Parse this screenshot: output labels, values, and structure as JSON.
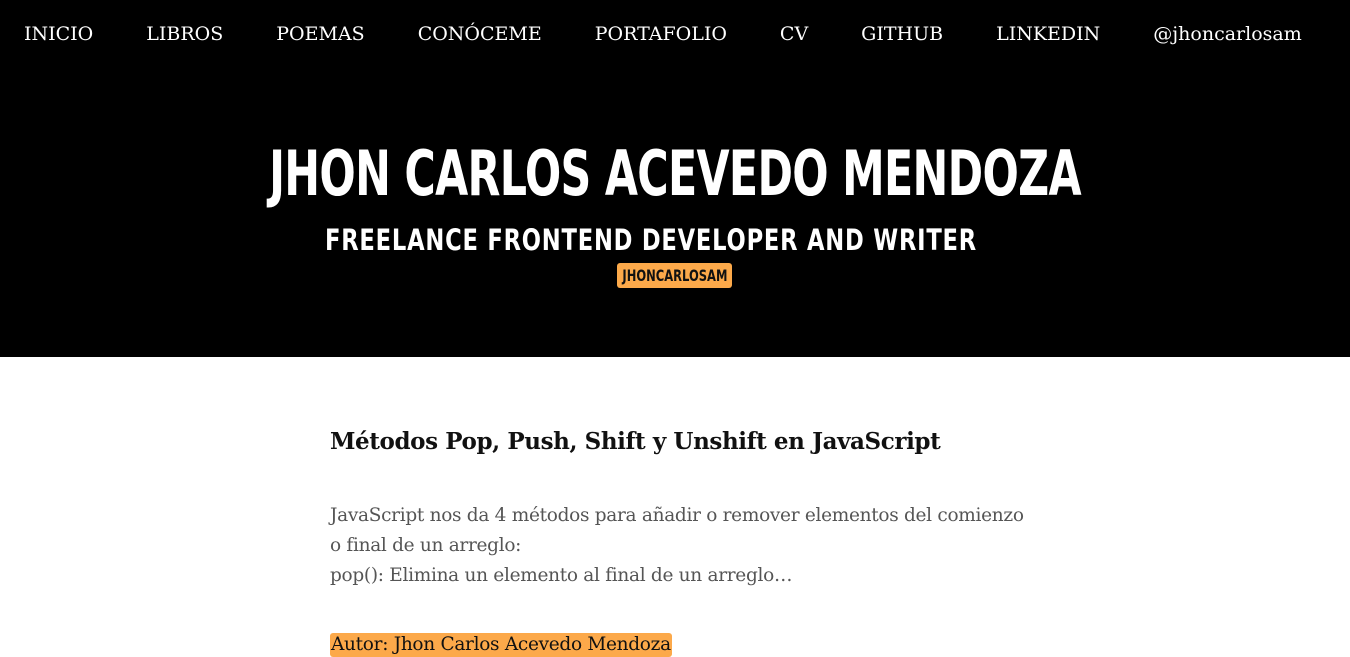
{
  "nav": {
    "items": [
      {
        "label": "INICIO"
      },
      {
        "label": "LIBROS"
      },
      {
        "label": "POEMAS"
      },
      {
        "label": "CONÓCEME"
      },
      {
        "label": "PORTAFOLIO"
      },
      {
        "label": "CV"
      },
      {
        "label": "GITHUB"
      },
      {
        "label": "LINKEDIN"
      },
      {
        "label": "@jhoncarlosam"
      }
    ]
  },
  "hero": {
    "title": "JHON CARLOS ACEVEDO MENDOZA",
    "subtitle": "FREELANCE FRONTEND DEVELOPER AND WRITER",
    "badge": "JHONCARLOSAM"
  },
  "post": {
    "title": "Métodos Pop, Push, Shift y Unshift en JavaScript",
    "excerpt_lines": [
      "JavaScript nos da 4 métodos para añadir o remover elementos del comienzo",
      "o final de un arreglo:",
      "pop(): Elimina un elemento al final de un arreglo…"
    ],
    "author": "Autor: Jhon Carlos Acevedo Mendoza"
  },
  "colors": {
    "header_bg": "#000000",
    "accent": "#fca94a",
    "text_muted": "#555555"
  }
}
